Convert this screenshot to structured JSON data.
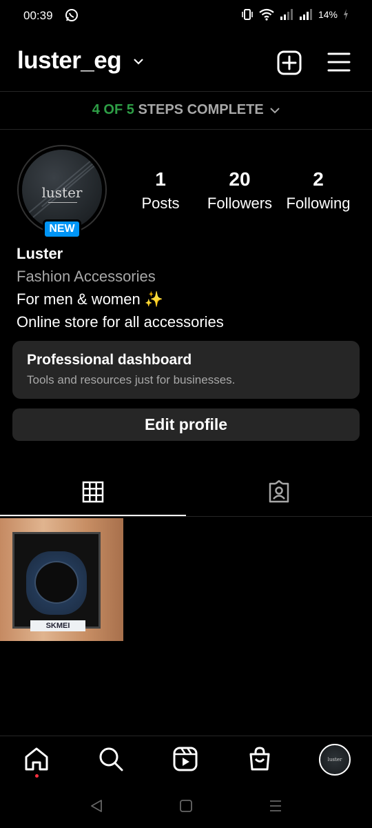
{
  "status_bar": {
    "time": "00:39",
    "battery": "14%"
  },
  "header": {
    "username": "luster_eg"
  },
  "steps_banner": {
    "progress": "4 OF 5",
    "label": "STEPS COMPLETE"
  },
  "profile": {
    "avatar_logo": "luster",
    "new_badge": "NEW",
    "stats": [
      {
        "value": "1",
        "label": "Posts"
      },
      {
        "value": "20",
        "label": "Followers"
      },
      {
        "value": "2",
        "label": "Following"
      }
    ],
    "name": "Luster",
    "category": "Fashion Accessories",
    "bio_lines": [
      "For men & women ✨",
      "Online store for all accessories"
    ]
  },
  "dashboard": {
    "title": "Professional dashboard",
    "subtitle": "Tools and resources just for businesses."
  },
  "edit_profile_label": "Edit profile",
  "posts": [
    {
      "brand_text": "SKMEI"
    }
  ],
  "colors": {
    "accent_blue": "#0095f6",
    "steps_green": "#2e9e46",
    "surface": "#262626",
    "notification_dot": "#ff3040"
  },
  "icons": {
    "header": [
      "chevron-down-icon",
      "plus-square-icon",
      "hamburger-menu-icon"
    ],
    "tabs": [
      "grid-icon",
      "tagged-person-icon"
    ],
    "bottom_nav": [
      "home-icon",
      "search-icon",
      "reels-icon",
      "shop-bag-icon",
      "profile-avatar"
    ],
    "system_nav": [
      "back-icon",
      "home-square-icon",
      "recents-icon"
    ]
  }
}
